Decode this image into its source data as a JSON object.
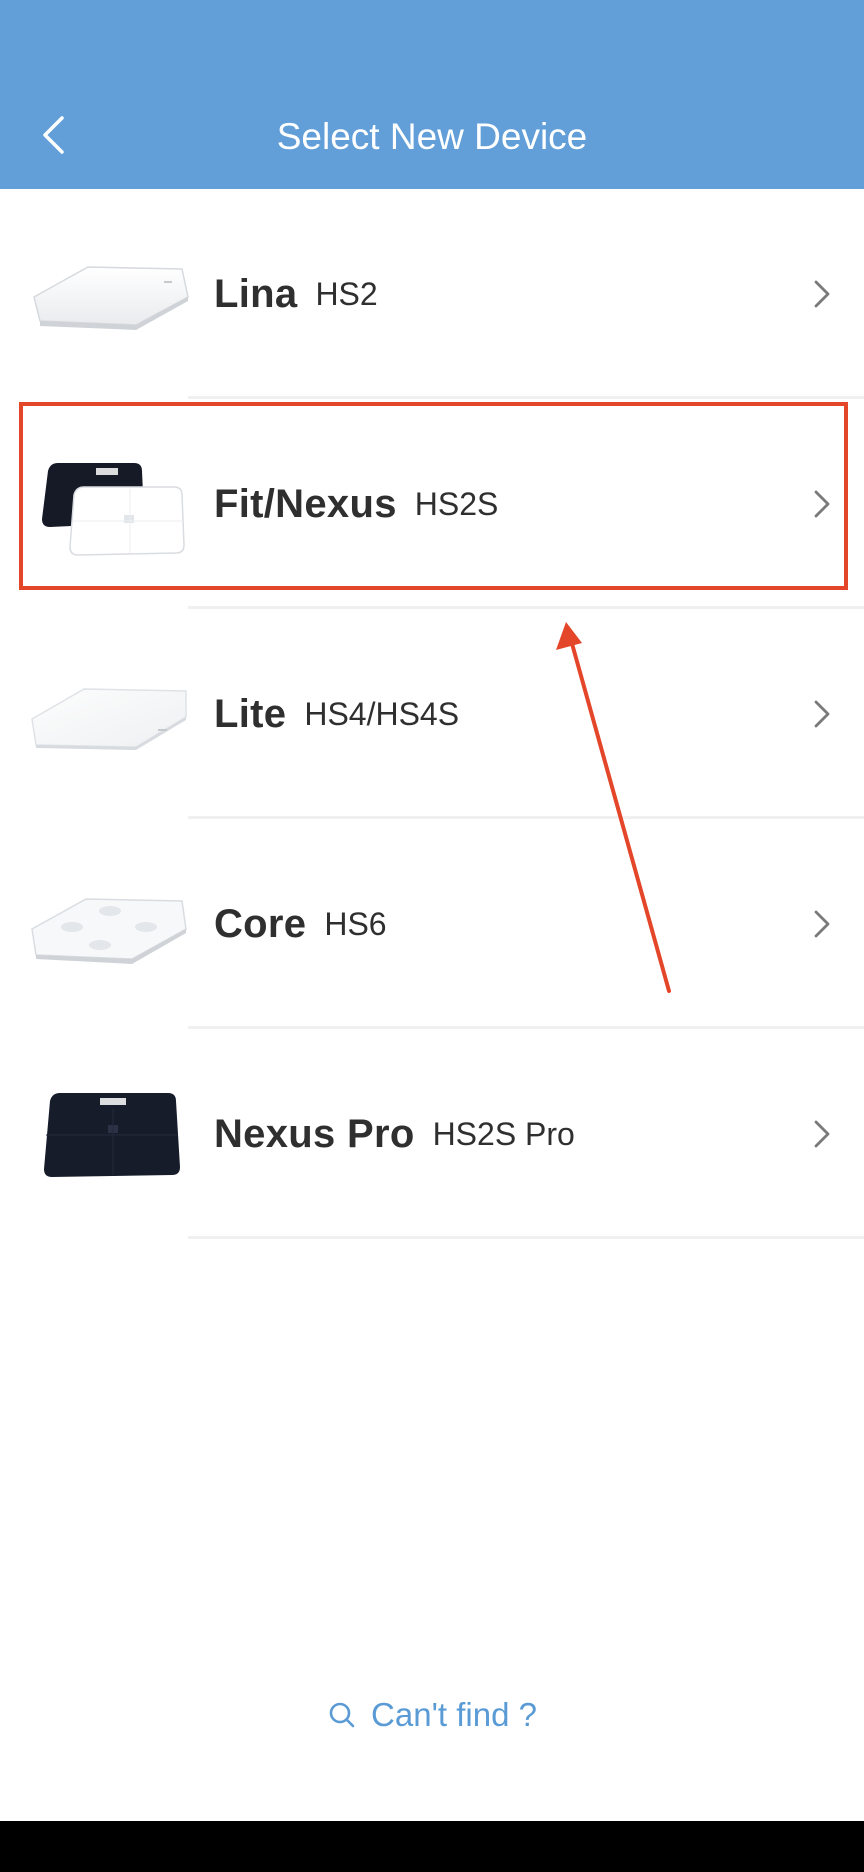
{
  "header": {
    "title": "Select New Device",
    "background_color": "#629fd8",
    "back_icon": "chevron-left-icon"
  },
  "devices": [
    {
      "name": "Lina",
      "model": "HS2",
      "image": "white-scale",
      "highlighted": false
    },
    {
      "name": "Fit/Nexus",
      "model": "HS2S",
      "image": "black-and-white-scales",
      "highlighted": true
    },
    {
      "name": "Lite",
      "model": "HS4/HS4S",
      "image": "white-glass-scale",
      "highlighted": false
    },
    {
      "name": "Core",
      "model": "HS6",
      "image": "white-scale-with-pads",
      "highlighted": false
    },
    {
      "name": "Nexus Pro",
      "model": "HS2S Pro",
      "image": "black-scale",
      "highlighted": false
    }
  ],
  "row_icon": "chevron-right-icon",
  "annotation": {
    "color": "#e4462a",
    "shapes": [
      "highlight-box",
      "arrow"
    ]
  },
  "footer": {
    "cant_find_label": "Can't find ?",
    "cant_find_icon": "search-icon",
    "link_color": "#5a9bd5"
  }
}
